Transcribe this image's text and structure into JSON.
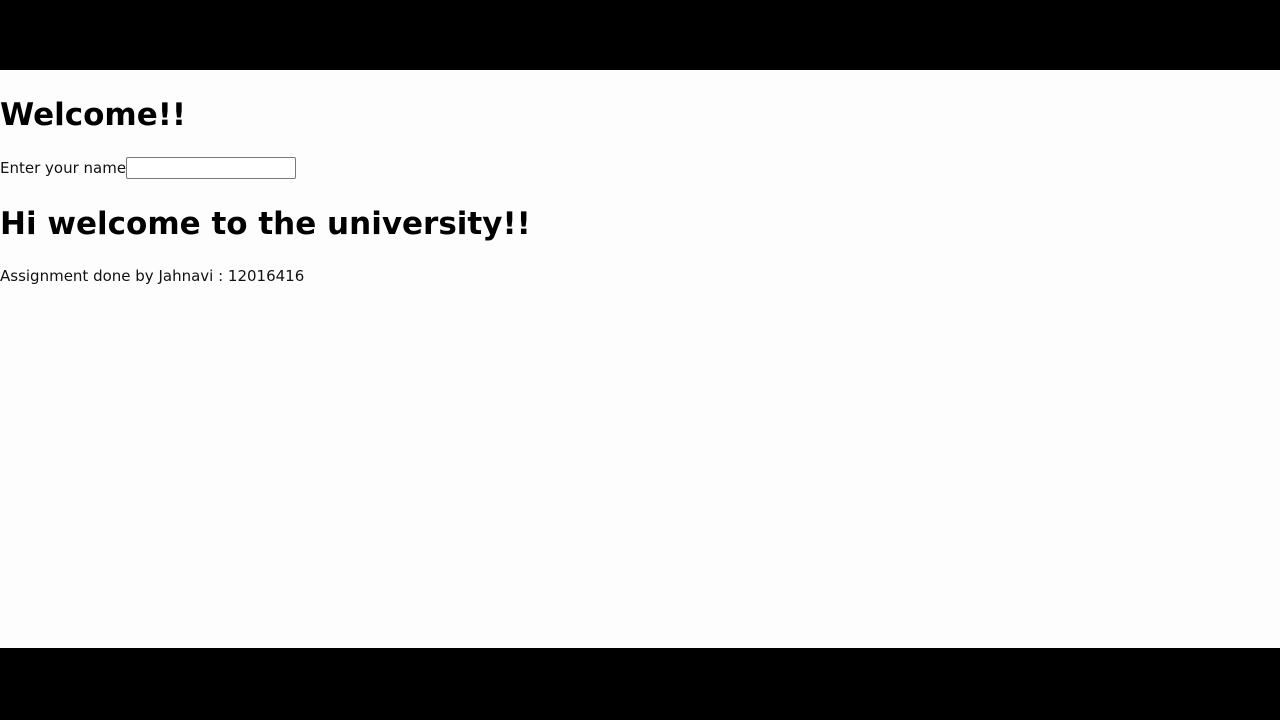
{
  "page": {
    "background": "#fdfdfd",
    "letterbox_color": "#000000"
  },
  "welcome_heading": "Welcome!!",
  "name_form": {
    "label": "Enter your name",
    "value": "",
    "placeholder": ""
  },
  "greeting_heading": "Hi welcome to the university!!",
  "footer_note": "Assignment done by Jahnavi : 12016416"
}
